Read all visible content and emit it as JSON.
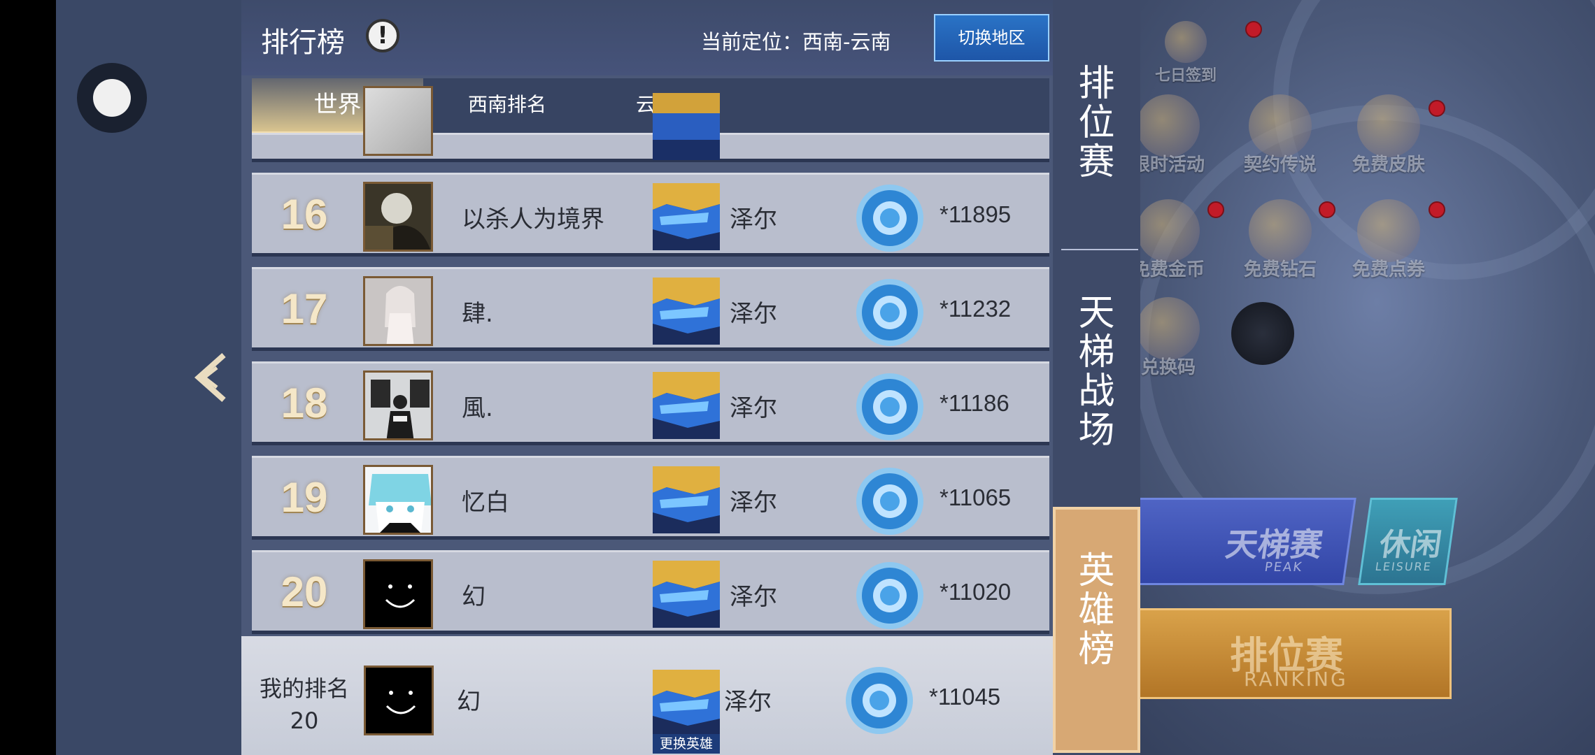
{
  "header": {
    "title": "排行榜",
    "help_symbol": "!",
    "location_label": "当前定位：西南-云南",
    "switch_region_button": "切换地区"
  },
  "tabs": [
    {
      "label": "世界",
      "active": true
    },
    {
      "label": "西南排名",
      "active": false
    },
    {
      "label": "云南排名",
      "active": false
    }
  ],
  "rows": [
    {
      "rank": "16",
      "name": "以杀人为境界",
      "hero": "泽尔",
      "score": "*11895",
      "avatar": "photo-dark"
    },
    {
      "rank": "17",
      "name": "肆.",
      "hero": "泽尔",
      "score": "*11232",
      "avatar": "photo-girl"
    },
    {
      "rank": "18",
      "name": "風.",
      "hero": "泽尔",
      "score": "*11186",
      "avatar": "photo-room"
    },
    {
      "rank": "19",
      "name": "忆白",
      "hero": "泽尔",
      "score": "*11065",
      "avatar": "anime"
    },
    {
      "rank": "20",
      "name": "幻",
      "hero": "泽尔",
      "score": "*11020",
      "avatar": "smiley"
    }
  ],
  "my_rank": {
    "label": "我的排名",
    "rank": "20",
    "name": "幻",
    "hero": "泽尔",
    "score": "*11045",
    "change_hero_button": "更换英雄"
  },
  "side_tabs": [
    {
      "label": "排位赛",
      "active": false
    },
    {
      "label": "天梯战场",
      "active": false
    },
    {
      "label": "英雄榜",
      "active": true
    }
  ],
  "background_menu": {
    "items": [
      "七日签到",
      "限时活动",
      "契约传说",
      "免费皮肤",
      "免费金币",
      "免费钻石",
      "免费点券",
      "兑换码"
    ],
    "peak": {
      "title": "天梯赛",
      "sub": "PEAK"
    },
    "leisure": {
      "title": "休闲",
      "sub": "LEISURE"
    },
    "ranking": {
      "title": "排位赛",
      "sub": "RANKING"
    }
  },
  "colors": {
    "panel": "#4b5878",
    "row": "#b9becd",
    "rank_text": "#f5e7c8",
    "switch_button": "#1e56a8",
    "active_side_tab": "#d7a874"
  }
}
